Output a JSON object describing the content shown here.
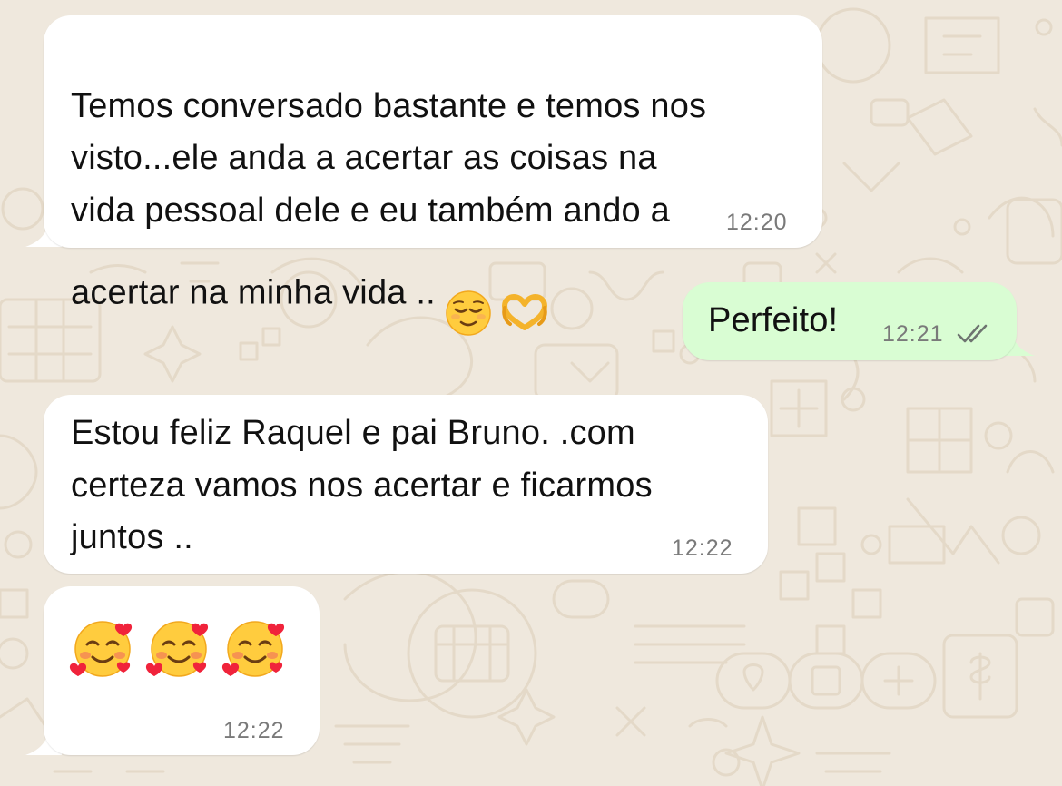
{
  "theme": {
    "wallpaper": "#efe8dd",
    "incoming_bubble": "#ffffff",
    "outgoing_bubble": "#d9fdd3",
    "text": "#111111",
    "timestamp": "#7a7a7a",
    "read_ticks": "#6e7470"
  },
  "messages": [
    {
      "direction": "incoming",
      "text": "Temos conversado bastante e temos nos\nvisto...ele anda a acertar as coisas na\nvida pessoal dele e eu também ando a\nacertar na minha vida ..",
      "emojis": [
        "relieved-face",
        "heart-hands"
      ],
      "time": "12:20"
    },
    {
      "direction": "outgoing",
      "text": "Perfeito!",
      "time": "12:21",
      "status": "read-double-check"
    },
    {
      "direction": "incoming",
      "text": "Estou feliz Raquel e pai Bruno. .com\ncerteza vamos nos acertar e ficarmos\njuntos ..",
      "time": "12:22"
    },
    {
      "direction": "incoming",
      "text": "",
      "emojis": [
        "smiling-face-with-hearts",
        "smiling-face-with-hearts",
        "smiling-face-with-hearts"
      ],
      "time": "12:22"
    }
  ]
}
